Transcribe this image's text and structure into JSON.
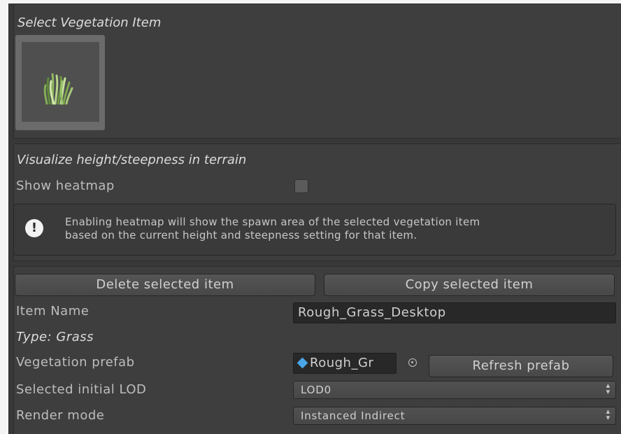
{
  "sections": {
    "select_title": "Select Vegetation Item",
    "visualize_title": "Visualize height/steepness in terrain"
  },
  "heatmap": {
    "label": "Show heatmap",
    "checked": false,
    "help_line1": "Enabling heatmap will show the spawn area of the selected vegetation item",
    "help_line2": "based on the current height and steepness setting for that item."
  },
  "buttons": {
    "delete": "Delete selected item",
    "copy": "Copy selected item",
    "refresh": "Refresh prefab"
  },
  "fields": {
    "item_name_label": "Item Name",
    "item_name_value": "Rough_Grass_Desktop",
    "type_label": "Type: Grass",
    "prefab_label": "Vegetation prefab",
    "prefab_value": "Rough_Gr",
    "lod_label": "Selected initial LOD",
    "lod_value": "LOD0",
    "render_label": "Render mode",
    "render_value": "Instanced Indirect"
  },
  "colors": {
    "panel_bg": "#383838",
    "section_bg": "#3e3e3e",
    "prefab_icon": "#4aa6e8"
  }
}
